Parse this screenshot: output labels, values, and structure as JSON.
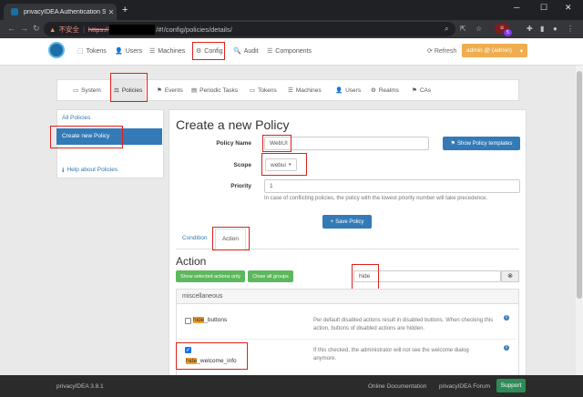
{
  "browser": {
    "tab_title": "privacyIDEA Authentication Sy",
    "tab_close": "✕",
    "new_tab": "+",
    "insecure_label": "不安全",
    "url_scheme": "https://",
    "url_path": "/#!/config/policies/details/",
    "back_icon": "arrow-left-icon",
    "forward_icon": "arrow-right-icon",
    "reload_icon": "reload-icon",
    "ext_badge": "5"
  },
  "appnav": {
    "items": [
      {
        "icon": "⬚",
        "label": "Tokens"
      },
      {
        "icon": "👤",
        "label": "Users"
      },
      {
        "icon": "☰",
        "label": "Machines"
      },
      {
        "icon": "⚙",
        "label": "Config"
      },
      {
        "icon": "🔍",
        "label": "Audit"
      },
      {
        "icon": "☰",
        "label": "Components"
      }
    ],
    "refresh_label": "Refresh",
    "admin_label": "admin @ (admin)",
    "admin_caret": "▾"
  },
  "subnav": {
    "items": [
      {
        "icon": "▭",
        "label": "System"
      },
      {
        "icon": "⚖",
        "label": "Policies"
      },
      {
        "icon": "⚑",
        "label": "Events"
      },
      {
        "icon": "▤",
        "label": "Periodic Tasks"
      },
      {
        "icon": "▭",
        "label": "Tokens"
      },
      {
        "icon": "☰",
        "label": "Machines"
      },
      {
        "icon": "👤",
        "label": "Users"
      },
      {
        "icon": "⚙",
        "label": "Realms"
      },
      {
        "icon": "⚑",
        "label": "CAs"
      }
    ]
  },
  "sidebar": {
    "all_policies": "All Policies",
    "create_new_policy": "Create new Policy",
    "help_icon": "ℹ",
    "help_about": "Help about Policies"
  },
  "form": {
    "title": "Create a new Policy",
    "policy_name_label": "Policy Name",
    "policy_name_value": "WebUI",
    "templates_button": "Show Policy templates",
    "templates_icon": "⚑",
    "scope_label": "Scope",
    "scope_value": "webui",
    "scope_caret": "▾",
    "priority_label": "Priority",
    "priority_value": "1",
    "priority_help": "In case of conflicting policies, the policy with the lowest priority number will take precedence.",
    "save_button": "Save Policy",
    "save_icon": "+"
  },
  "tabs": {
    "condition": "Condition",
    "action": "Action"
  },
  "action": {
    "heading": "Action",
    "show_selected": "Show selected actions only",
    "close_groups": "Close all groups",
    "filter_value": "hide",
    "filter_clear": "⊗",
    "group_name": "miscellaneous",
    "items": [
      {
        "highlight": "hide",
        "rest": "_buttons",
        "checked": false,
        "check_mark": "",
        "desc": "Per default disabled actions result in disabled buttons. When checking this action, buttons of disabled actions are hidden.",
        "info": "i"
      },
      {
        "highlight": "hide",
        "rest": "_welcome_info",
        "checked": true,
        "check_mark": "✓",
        "desc": "If this checked, the administrator will not see the welcome dialog anymore.",
        "info": "i"
      }
    ]
  },
  "footer": {
    "version": "privacyIDEA 3.8.1",
    "online_docs": "Online Documentation",
    "forum": "privacyIDEA Forum",
    "support": "Support"
  }
}
